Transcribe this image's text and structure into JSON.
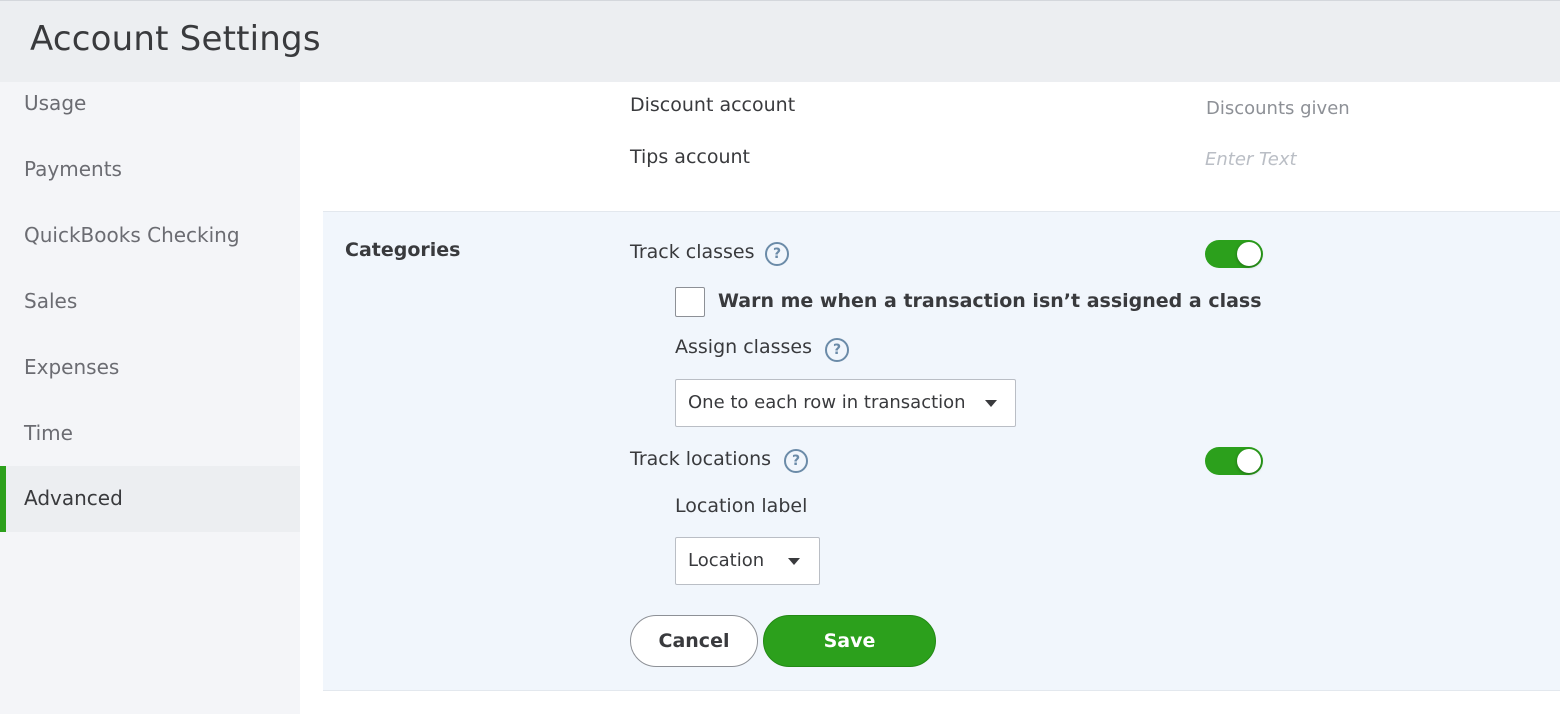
{
  "header": {
    "title": "Account Settings"
  },
  "sidebar": {
    "items": [
      {
        "label": "Usage",
        "active": false
      },
      {
        "label": "Payments",
        "active": false
      },
      {
        "label": "QuickBooks Checking",
        "active": false
      },
      {
        "label": "Sales",
        "active": false
      },
      {
        "label": "Expenses",
        "active": false
      },
      {
        "label": "Time",
        "active": false
      },
      {
        "label": "Advanced",
        "active": true
      }
    ]
  },
  "main": {
    "discount_account": {
      "label": "Discount account",
      "value": "Discounts given"
    },
    "tips_account": {
      "label": "Tips account",
      "placeholder": "Enter Text"
    },
    "categories": {
      "title": "Categories",
      "track_classes": {
        "label": "Track classes",
        "enabled": true
      },
      "warn_unassigned": {
        "label": "Warn me when a transaction isn’t assigned a class",
        "checked": false
      },
      "assign_classes": {
        "label": "Assign classes",
        "selected": "One to each row in transaction"
      },
      "track_locations": {
        "label": "Track locations",
        "enabled": true
      },
      "location_label": {
        "label": "Location label",
        "selected": "Location"
      },
      "help_glyph": "?",
      "cancel_label": "Cancel",
      "save_label": "Save"
    }
  },
  "colors": {
    "accent": "#2ca01c",
    "panel_bg": "#f1f6fc",
    "sidebar_bg": "#f4f5f8",
    "header_bg": "#eceef1",
    "help_icon": "#6b8ba8"
  },
  "icons": {
    "help": "question-circle-icon",
    "dropdown": "caret-down-icon"
  }
}
